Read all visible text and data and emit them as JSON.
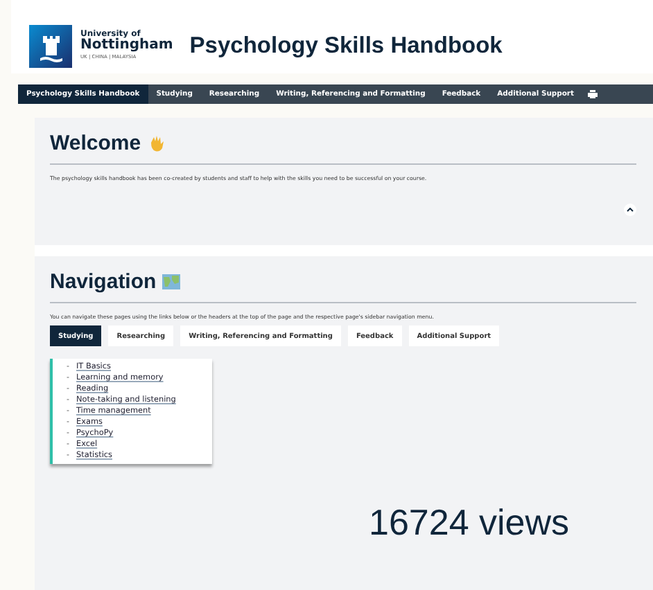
{
  "logo": {
    "line_1": "University of",
    "line_2": "Nottingham",
    "line_3": "UK | CHINA | MALAYSIA"
  },
  "site_title": "Psychology Skills Handbook",
  "top_nav": [
    {
      "label": "Psychology Skills Handbook",
      "selected": true
    },
    {
      "label": "Studying",
      "selected": false
    },
    {
      "label": "Researching",
      "selected": false
    },
    {
      "label": "Writing, Referencing and Formatting",
      "selected": false
    },
    {
      "label": "Feedback",
      "selected": false
    },
    {
      "label": "Additional Support",
      "selected": false
    }
  ],
  "welcome": {
    "heading": "Welcome",
    "text": "The psychology skills handbook has been co-created by students and staff to help with the skills you need to be successful on your course."
  },
  "navigation": {
    "heading": "Navigation",
    "text": "You can navigate these pages using the links below or the headers at the top of the page and the respective page's sidebar navigation menu.",
    "tabs": [
      {
        "label": "Studying",
        "selected": true
      },
      {
        "label": "Researching",
        "selected": false
      },
      {
        "label": "Writing, Referencing and Formatting",
        "selected": false
      },
      {
        "label": "Feedback",
        "selected": false
      },
      {
        "label": "Additional Support",
        "selected": false
      }
    ],
    "links": [
      {
        "bullet": "-",
        "label": "IT Basics"
      },
      {
        "bullet": "-",
        "label": "Learning and memory"
      },
      {
        "bullet": "-",
        "label": "Reading"
      },
      {
        "bullet": "-",
        "label": "Note-taking and listening"
      },
      {
        "bullet": "-",
        "label": "Time management"
      },
      {
        "bullet": "-",
        "label": "Exams"
      },
      {
        "bullet": "-",
        "label": "PsychoPy"
      },
      {
        "bullet": "-",
        "label": "Excel"
      },
      {
        "bullet": "-",
        "label": "Statistics"
      }
    ]
  },
  "views": "16724 views"
}
